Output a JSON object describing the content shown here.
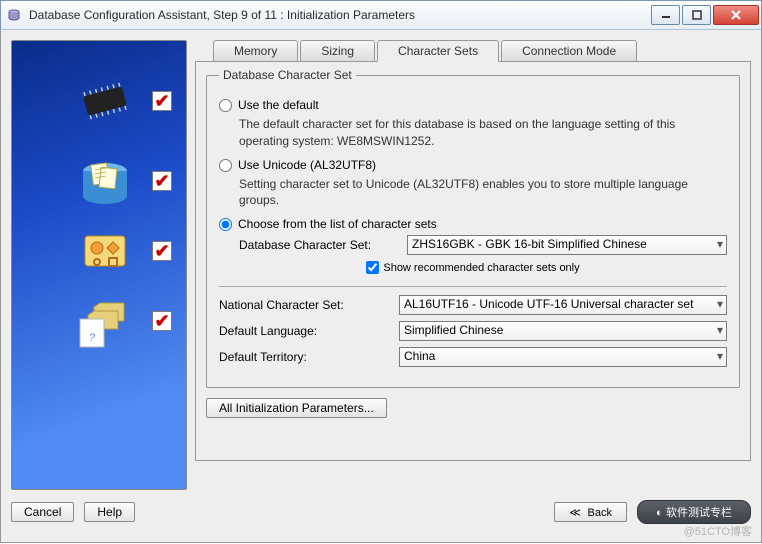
{
  "window": {
    "title": "Database Configuration Assistant, Step 9 of 11 : Initialization Parameters"
  },
  "tabs": {
    "memory": "Memory",
    "sizing": "Sizing",
    "charsets": "Character Sets",
    "connmode": "Connection Mode"
  },
  "group": {
    "legend": "Database Character Set",
    "opt1": {
      "label": "Use the default",
      "desc": "The default character set for this database is based on the language setting of this operating system: WE8MSWIN1252."
    },
    "opt2": {
      "label": "Use Unicode (AL32UTF8)",
      "desc": "Setting character set to Unicode (AL32UTF8) enables you to store multiple language groups."
    },
    "opt3": {
      "label": "Choose from the list of character sets"
    },
    "db_charset_label": "Database Character Set:",
    "db_charset_value": "ZHS16GBK - GBK 16-bit Simplified Chinese",
    "show_recommended": "Show recommended character sets only"
  },
  "fields": {
    "national_label": "National Character Set:",
    "national_value": "AL16UTF16 - Unicode UTF-16 Universal character set",
    "lang_label": "Default Language:",
    "lang_value": "Simplified Chinese",
    "territory_label": "Default Territory:",
    "territory_value": "China"
  },
  "buttons": {
    "all_params": "All Initialization Parameters...",
    "cancel": "Cancel",
    "help": "Help",
    "back": "Back",
    "next": "软件测试专栏"
  },
  "watermark": "@51CTO博客"
}
